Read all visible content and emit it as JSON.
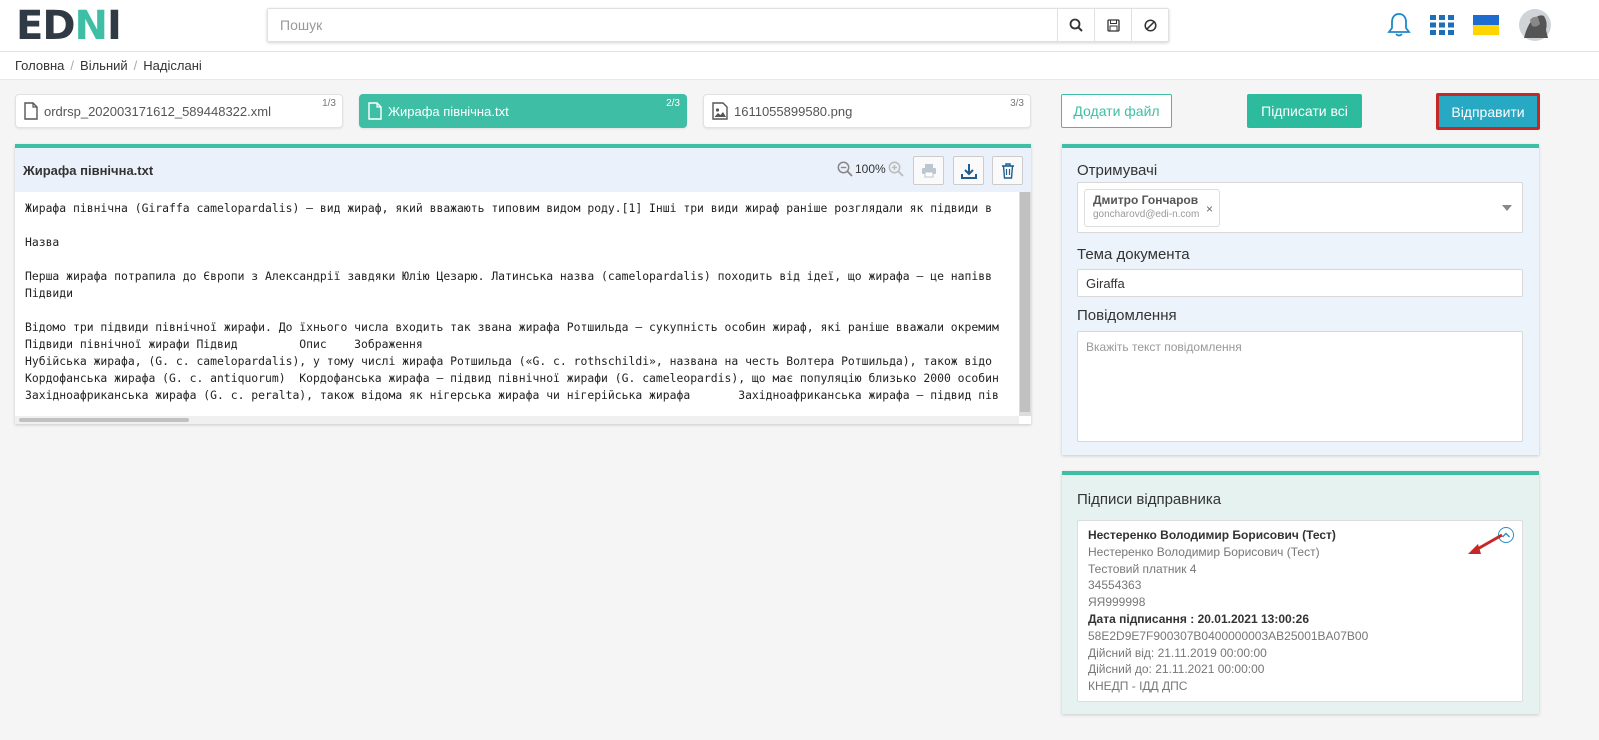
{
  "header": {
    "logo_text_1": "ED",
    "logo_text_2": "N",
    "logo_text_3": "I",
    "search_placeholder": "Пошук",
    "search_icon": "search-icon",
    "save_icon": "save-icon",
    "clear_icon": "clear-icon",
    "bell_icon": "bell-icon",
    "apps_icon": "apps-grid-icon",
    "flag_icon": "ukraine-flag-icon",
    "avatar_icon": "avatar"
  },
  "breadcrumb": {
    "items": [
      "Головна",
      "Вільний",
      "Надіслані"
    ],
    "separator": "/"
  },
  "files": [
    {
      "name": "ordrsp_202003171612_589448322.xml",
      "count": "1/3",
      "icon": "file-icon",
      "active": false
    },
    {
      "name": "Жирафа північна.txt",
      "count": "2/3",
      "icon": "file-icon",
      "active": true
    },
    {
      "name": "1611055899580.png",
      "count": "3/3",
      "icon": "image-icon",
      "active": false
    }
  ],
  "actions": {
    "add_file": "Додати файл",
    "sign_all": "Підписати всі",
    "send": "Відправити"
  },
  "viewer": {
    "title": "Жирафа північна.txt",
    "zoom": "100%",
    "lines": [
      "Жирафа північна (Giraffa camelopardalis) — вид жираф, який вважають типовим видом роду.[1] Інші три види жираф раніше розглядали як підвиди в",
      "",
      "Назва",
      "",
      "Перша жирафа потрапила до Європи з Александрії завдяки Юлію Цезарю. Латинська назва (camelopardalis) походить від ідеї, що жирафа — це напівв",
      "Підвиди",
      "",
      "Відомо три підвиди північної жирафи. До їхнього числа входить так звана жирафа Ротшильда — сукупність особин жираф, які раніше вважали окремим",
      "Підвиди північної жирафи Підвид         Опис    Зображення",
      "Нубійська жирафа, (G. c. camelopardalis), у тому числі жирафа Ротшильда («G. c. rothschildi», названа на честь Волтера Ротшильда), також відо",
      "Кордофанська жирафа (G. c. antiquorum)  Кордофанська жирафа — підвид північної жирафи (G. cameleopardis), що має популяцію близько 2000 особин",
      "Західноафриканська жирафа (G. c. peralta), також відома як нігерська жирафа чи нігерійська жирафа       Західноафриканська жирафа — підвид пів"
    ]
  },
  "form": {
    "recipients_label": "Отримувачі",
    "recipient": {
      "name": "Дмитро Гончаров",
      "email": "goncharovd@edi-n.com",
      "remove": "×"
    },
    "subject_label": "Тема документа",
    "subject_value": "Giraffa",
    "message_label": "Повідомлення",
    "message_placeholder": "Вкажіть текст повідомлення"
  },
  "signatures": {
    "title": "Підписи відправника",
    "signer_bold": "Нестеренко Володимир Борисович (Тест)",
    "signer": "Нестеренко Володимир Борисович (Тест)",
    "org": "Тестовий платник 4",
    "code": "34554363",
    "id": "ЯЯ999998",
    "sign_date": "Дата підписання : 20.01.2021 13:00:26",
    "serial": "58E2D9E7F900307B0400000003AB25001BA07B00",
    "valid_from": "Дійсний від: 21.11.2019 00:00:00",
    "valid_to": "Дійсний до: 21.11.2021 00:00:00",
    "issuer": "КНЕДП - ІДД ДПС"
  },
  "colors": {
    "accent": "#3ebfa5",
    "send": "#27a8c3",
    "highlight": "#c62828"
  }
}
